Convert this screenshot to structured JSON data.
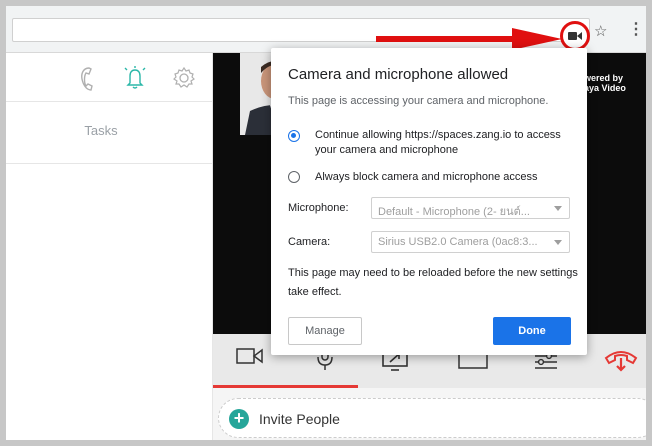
{
  "browser": {
    "camera_indicator_icon": "camera-icon",
    "bookmark_icon": "star-icon",
    "menu_icon": "vertical-dots-icon"
  },
  "sidebar": {
    "icons": [
      "phone-icon",
      "bell-icon",
      "gear-icon"
    ],
    "tasks_label": "Tasks"
  },
  "video": {
    "powered_line1": "wered by",
    "powered_line2": "aya Video"
  },
  "toolbar": {
    "buttons": [
      "video-camera-icon",
      "microphone-icon",
      "screen-share-icon",
      "layout-icon",
      "settings-sliders-icon",
      "hang-up-icon"
    ],
    "hangup_color": "#e53935"
  },
  "invite": {
    "label": "Invite People"
  },
  "popup": {
    "title": "Camera and microphone allowed",
    "description": "This page is accessing your camera and microphone.",
    "option_allow": "Continue allowing https://spaces.zang.io to access your camera and microphone",
    "option_block": "Always block camera and microphone access",
    "selected_option": "allow",
    "microphone_label": "Microphone:",
    "microphone_value": "Default - Microphone (2- ยนต์...",
    "camera_label": "Camera:",
    "camera_value": "Sirius USB2.0 Camera (0ac8:3...",
    "note": "This page may need to be reloaded before the new settings take effect.",
    "manage_label": "Manage",
    "done_label": "Done"
  },
  "colors": {
    "accent": "#1a73e8",
    "annotation": "#e01010"
  }
}
